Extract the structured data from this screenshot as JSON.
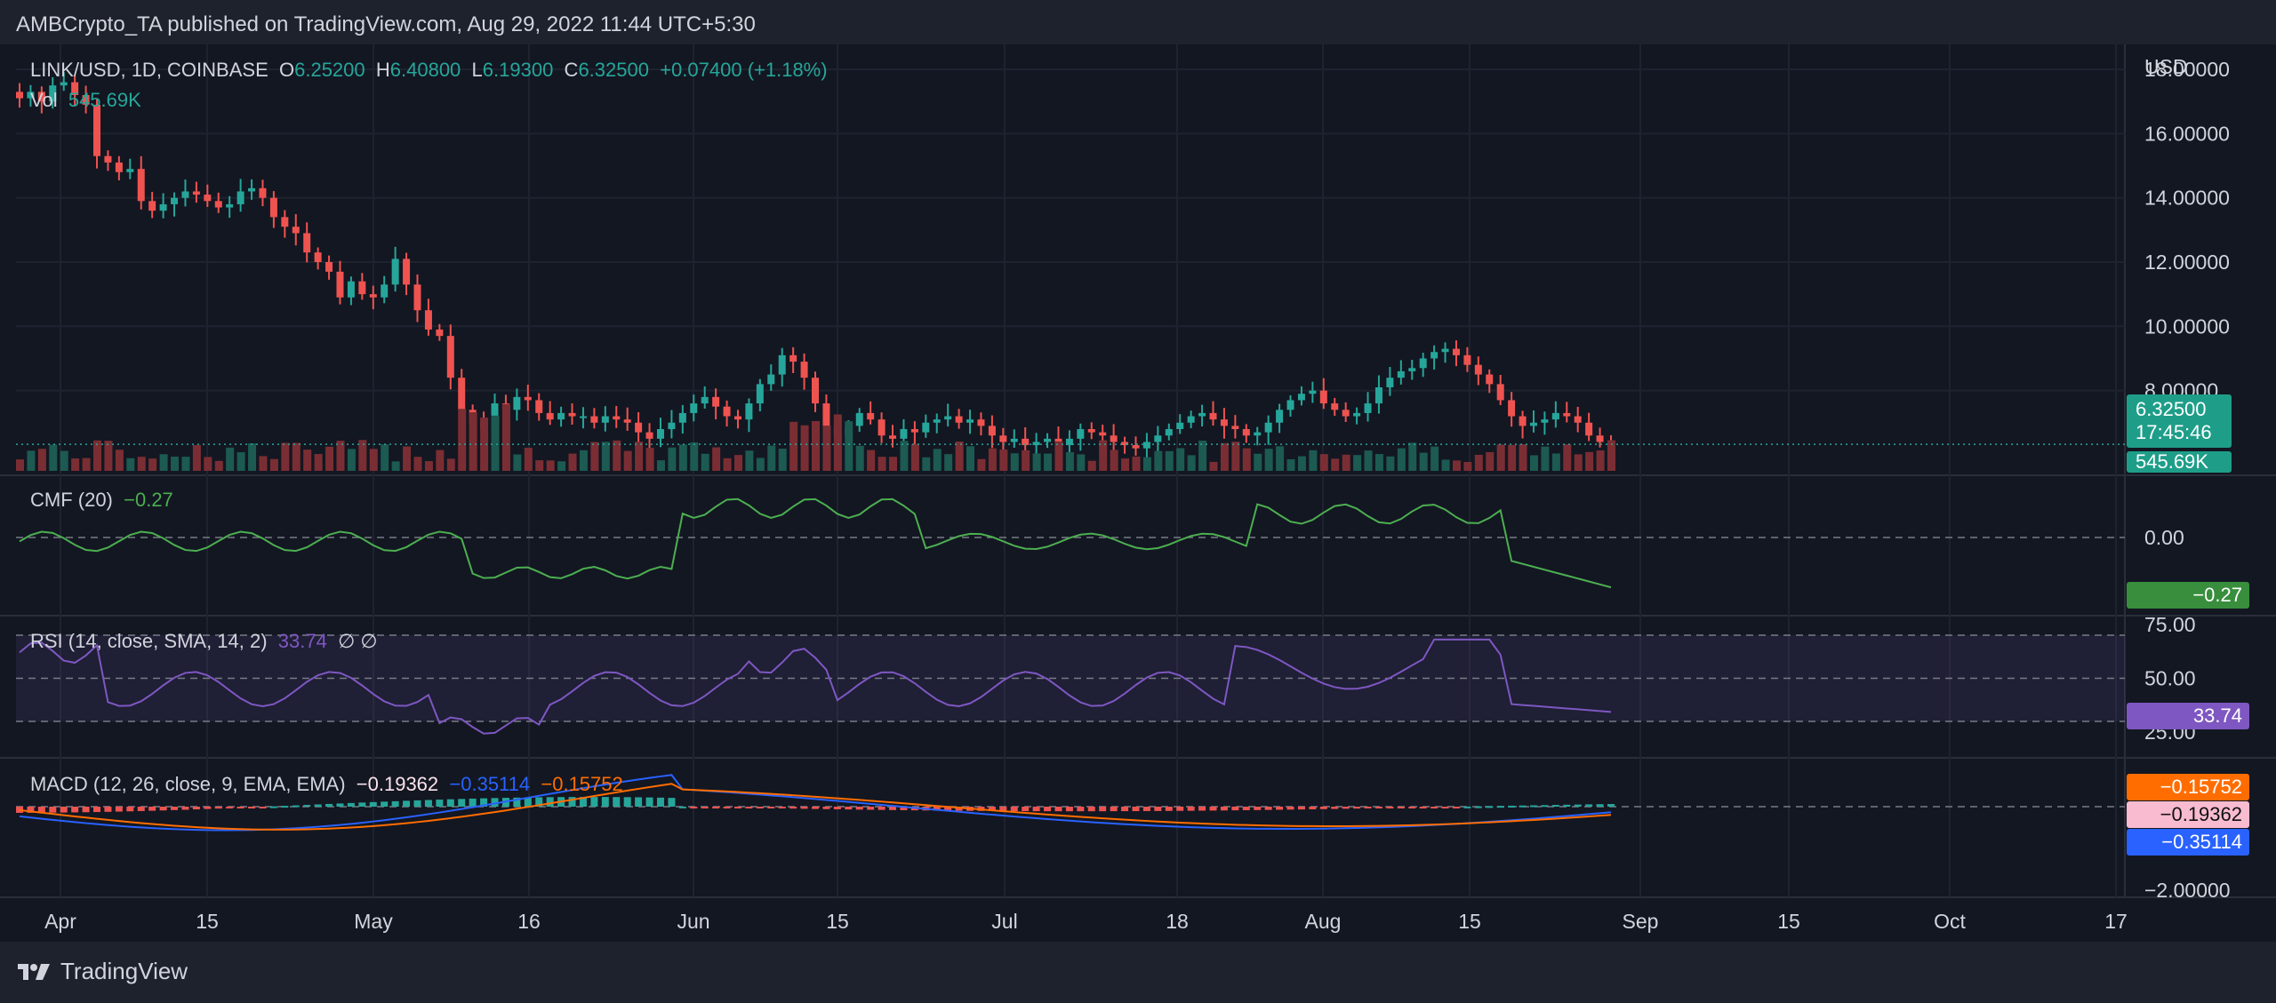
{
  "header": {
    "published_by": "AMBCrypto_TA published on TradingView.com, Aug 29, 2022 11:44 UTC+5:30"
  },
  "footer": {
    "brand": "TradingView"
  },
  "price_legend": {
    "symbol": "LINK/USD, 1D, COINBASE",
    "open_label": "O",
    "open": "6.25200",
    "high_label": "H",
    "high": "6.40800",
    "low_label": "L",
    "low": "6.19300",
    "close_label": "C",
    "close": "6.32500",
    "change": "+0.07400 (+1.18%)",
    "vol_label": "Vol",
    "vol": "545.69K"
  },
  "price_axis": {
    "unit": "USD",
    "ticks": [
      "18.00000",
      "16.00000",
      "14.00000",
      "12.00000",
      "10.00000",
      "8.00000"
    ],
    "current_price": "6.32500",
    "countdown": "17:45:46",
    "volume_tag": "545.69K"
  },
  "cmf": {
    "label": "CMF (20)",
    "value": "−0.27",
    "ticks": [
      "0.00"
    ],
    "tag": "−0.27"
  },
  "rsi": {
    "label": "RSI (14, close, SMA, 14, 2)",
    "value": "33.74",
    "extra": "∅ ∅",
    "ticks": [
      "75.00",
      "50.00",
      "25.00"
    ],
    "tag": "33.74"
  },
  "macd": {
    "label": "MACD (12, 26, close, 9, EMA, EMA)",
    "hist": "−0.19362",
    "macd": "−0.35114",
    "signal": "−0.15752",
    "ticks": [
      "−2.00000"
    ],
    "tag_signal": "−0.15752",
    "tag_hist": "−0.19362",
    "tag_macd": "−0.35114"
  },
  "time_axis": [
    "Apr",
    "15",
    "May",
    "16",
    "Jun",
    "15",
    "Jul",
    "18",
    "Aug",
    "15",
    "Sep",
    "15",
    "Oct",
    "17"
  ],
  "colors": {
    "up": "#26a69a",
    "down": "#ef5350",
    "bg": "#1e222d",
    "grid": "#2a2e39",
    "cmf": "#4caf50",
    "rsi": "#7e57c2",
    "macd": "#2962ff",
    "signal": "#ff6d00"
  },
  "chart_data": [
    {
      "type": "candlestick",
      "title": "LINK/USD, 1D, COINBASE",
      "ylabel": "USD",
      "ylim": [
        5.5,
        18.5
      ],
      "x_range": [
        "2022-03-28",
        "2022-08-29"
      ],
      "closes_approx": [
        17.1,
        17.3,
        17.0,
        17.5,
        17.6,
        17.2,
        16.9,
        15.3,
        15.1,
        14.8,
        14.9,
        13.9,
        13.6,
        13.8,
        14.0,
        14.2,
        14.1,
        13.9,
        13.7,
        13.8,
        14.2,
        14.3,
        14.0,
        13.4,
        13.1,
        12.9,
        12.3,
        12.0,
        11.7,
        10.9,
        11.4,
        11.0,
        10.9,
        11.3,
        12.1,
        11.3,
        10.5,
        9.9,
        9.7,
        8.4,
        7.4,
        7.0,
        6.8,
        7.6,
        7.4,
        7.8,
        7.7,
        7.3,
        7.1,
        7.3,
        7.2,
        7.2,
        7.0,
        7.2,
        7.1,
        7.0,
        6.7,
        6.5,
        6.8,
        7.0,
        7.3,
        7.6,
        7.8,
        7.5,
        7.2,
        7.1,
        7.6,
        8.2,
        8.5,
        9.1,
        8.9,
        8.4,
        7.6,
        6.9,
        6.6,
        6.9,
        7.3,
        7.1,
        6.6,
        6.5,
        6.8,
        6.7,
        7.0,
        7.1,
        7.2,
        7.0,
        7.1,
        6.9,
        6.6,
        6.4,
        6.5,
        6.3,
        6.4,
        6.5,
        6.3,
        6.5,
        6.8,
        6.7,
        6.6,
        6.4,
        6.3,
        6.2,
        6.4,
        6.6,
        6.8,
        7.0,
        7.2,
        7.3,
        7.1,
        6.9,
        6.8,
        6.6,
        6.7,
        7.0,
        7.4,
        7.7,
        7.9,
        8.0,
        7.6,
        7.4,
        7.2,
        7.3,
        7.6,
        8.1,
        8.4,
        8.6,
        8.7,
        9.0,
        9.2,
        9.3,
        9.1,
        8.8,
        8.5,
        8.2,
        7.7,
        7.2,
        6.9,
        7.0,
        7.1,
        7.3,
        7.2,
        7.0,
        6.6,
        6.4,
        6.33
      ],
      "last": {
        "open": 6.252,
        "high": 6.408,
        "low": 6.193,
        "close": 6.325
      }
    },
    {
      "type": "line",
      "title": "CMF (20)",
      "last_value": -0.27,
      "reference_line": 0.0
    },
    {
      "type": "line",
      "title": "RSI (14, close, SMA, 14, 2)",
      "ylim": [
        20,
        80
      ],
      "bands": [
        30,
        70
      ],
      "mid": 50,
      "last_value": 33.74
    },
    {
      "type": "line",
      "title": "MACD (12, 26, close, 9, EMA, EMA)",
      "series": [
        {
          "name": "MACD",
          "last_value": -0.35114
        },
        {
          "name": "Signal",
          "last_value": -0.15752
        },
        {
          "name": "Histogram",
          "last_value": -0.19362
        }
      ]
    }
  ]
}
